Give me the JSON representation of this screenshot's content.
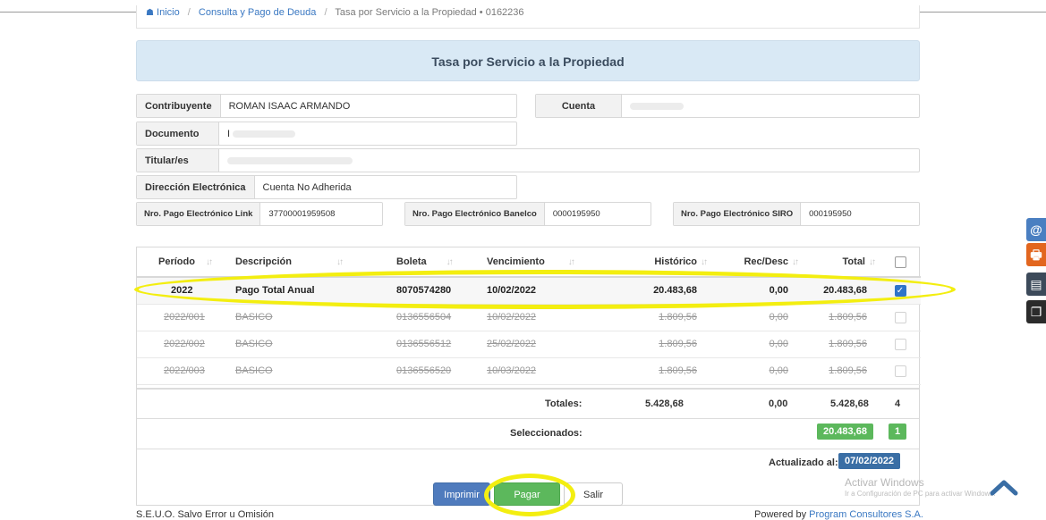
{
  "breadcrumb": {
    "home": "Inicio",
    "section": "Consulta y Pago de Deuda",
    "current": "Tasa por Servicio a la Propiedad • 0162236"
  },
  "page": {
    "title": "Tasa por Servicio a la Propiedad"
  },
  "form": {
    "contribuyente": {
      "label": "Contribuyente",
      "value": "ROMAN ISAAC ARMANDO"
    },
    "cuenta": {
      "label": "Cuenta",
      "value": ""
    },
    "documento": {
      "label": "Documento",
      "value": "I"
    },
    "titulares": {
      "label": "Titular/es",
      "value": ""
    },
    "direccion": {
      "label": "Dirección Electrónica",
      "value": "Cuenta No Adherida"
    },
    "link": {
      "label": "Nro. Pago Electrónico Link",
      "value": "37700001959508"
    },
    "banelco": {
      "label": "Nro. Pago Electrónico Banelco",
      "value": "0000195950"
    },
    "siro": {
      "label": "Nro. Pago Electrónico SIRO",
      "value": "000195950"
    }
  },
  "table": {
    "headers": [
      "Período",
      "Descripción",
      "Boleta",
      "Vencimiento",
      "Histórico",
      "Rec/Desc",
      "Total"
    ],
    "rows": [
      {
        "periodo": "2022",
        "descripcion": "Pago Total Anual",
        "boleta": "8070574280",
        "vencimiento": "10/02/2022",
        "historico": "20.483,68",
        "rec": "0,00",
        "total": "20.483,68",
        "checked": true
      },
      {
        "periodo": "2022/001",
        "descripcion": "BASICO",
        "boleta": "0136556504",
        "vencimiento": "10/02/2022",
        "historico": "1.809,56",
        "rec": "0,00",
        "total": "1.809,56",
        "checked": false
      },
      {
        "periodo": "2022/002",
        "descripcion": "BASICO",
        "boleta": "0136556512",
        "vencimiento": "25/02/2022",
        "historico": "1.809,56",
        "rec": "0,00",
        "total": "1.809,56",
        "checked": false
      },
      {
        "periodo": "2022/003",
        "descripcion": "BASICO",
        "boleta": "0136556520",
        "vencimiento": "10/03/2022",
        "historico": "1.809,56",
        "rec": "0,00",
        "total": "1.809,56",
        "checked": false
      }
    ]
  },
  "totals": {
    "label": "Totales:",
    "historico": "5.428,68",
    "rec": "0,00",
    "total": "5.428,68",
    "count": "4",
    "selected_label": "Seleccionados:",
    "selected_total": "20.483,68",
    "selected_count": "1",
    "updated_label": "Actualizado al:",
    "updated_date": "07/02/2022"
  },
  "buttons": {
    "print": "Imprimir",
    "pay": "Pagar",
    "exit": "Salir"
  },
  "side_icons": [
    {
      "glyph": "@",
      "color": "#4a7fc1"
    },
    {
      "glyph": "🖶",
      "color": "#e2661f"
    },
    {
      "glyph": "▤",
      "color": "#3c4a5a"
    },
    {
      "glyph": "❐",
      "color": "#2b2b2b"
    }
  ],
  "footer": {
    "left": "S.E.U.O. Salvo Error u Omisión",
    "right_prefix": "Powered by ",
    "right_link": "Program Consultores S.A."
  },
  "watermark": {
    "line1": "Activar Windows",
    "line2": "Ir a Configuración de PC para activar Windows."
  },
  "colors": {
    "highlight": "#f3ee10",
    "panel": "#d9e9f5",
    "success": "#5cb85c",
    "primary": "#4f7bbd"
  }
}
